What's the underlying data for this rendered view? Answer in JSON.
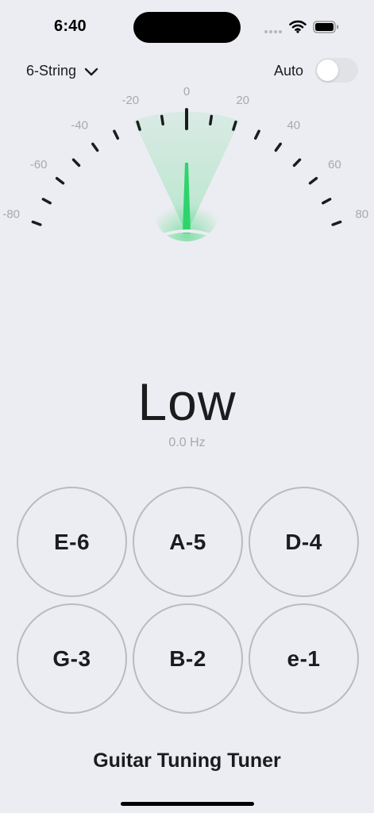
{
  "status_bar": {
    "time": "6:40"
  },
  "controls": {
    "string_mode": "6-String",
    "auto_label": "Auto",
    "auto_enabled": false
  },
  "gauge": {
    "scale_labels": [
      "-80",
      "-60",
      "-40",
      "-20",
      "0",
      "20",
      "40",
      "60",
      "80"
    ],
    "range": [
      -80,
      80
    ],
    "needle_value": 0,
    "accent_color": "#2fd36c"
  },
  "reading": {
    "status": "Low",
    "frequency": "0.0 Hz"
  },
  "strings": [
    {
      "label": "E-6"
    },
    {
      "label": "A-5"
    },
    {
      "label": "D-4"
    },
    {
      "label": "G-3"
    },
    {
      "label": "B-2"
    },
    {
      "label": "e-1"
    }
  ],
  "footer": {
    "title": "Guitar Tuning Tuner"
  }
}
